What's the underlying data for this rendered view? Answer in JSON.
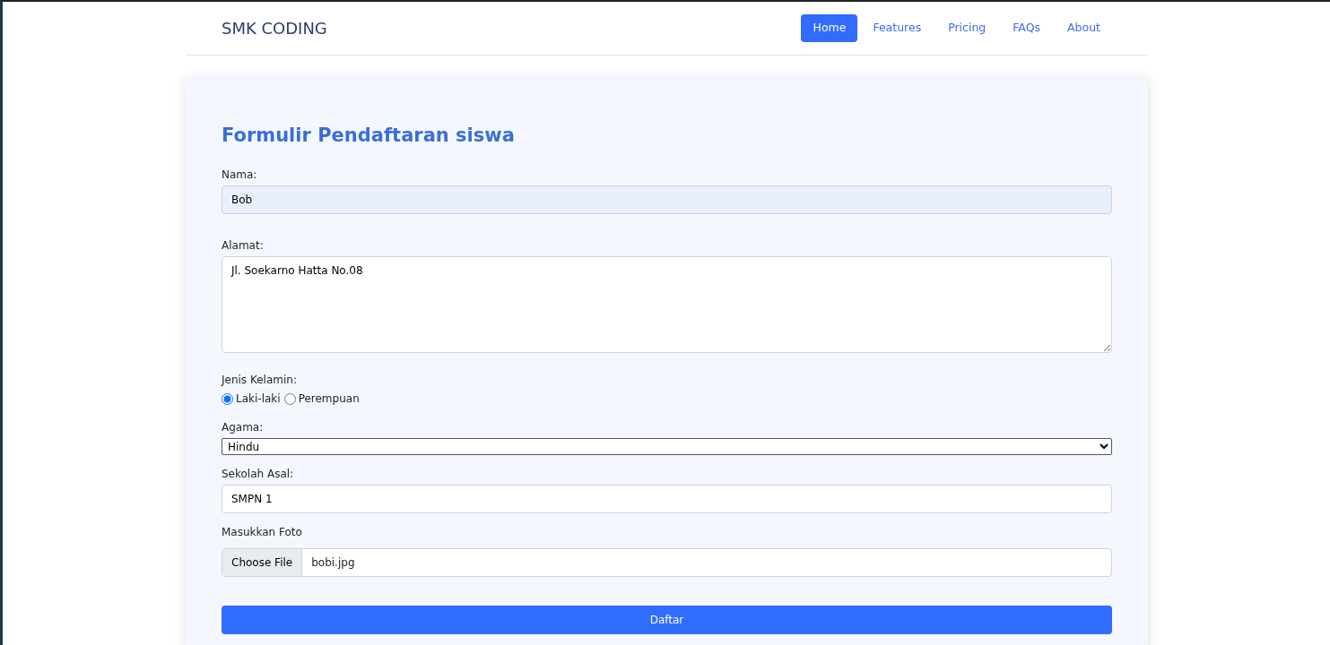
{
  "brand": "SMK CODING",
  "nav": [
    {
      "label": "Home",
      "selected": true
    },
    {
      "label": "Features",
      "selected": false
    },
    {
      "label": "Pricing",
      "selected": false
    },
    {
      "label": "FAQs",
      "selected": false
    },
    {
      "label": "About",
      "selected": false
    }
  ],
  "form": {
    "title": "Formulir Pendaftaran siswa",
    "nama": {
      "label": "Nama:",
      "value": "Bob"
    },
    "alamat": {
      "label": "Alamat:",
      "value": "Jl. Soekarno Hatta No.08"
    },
    "jenis_kelamin": {
      "label": "Jenis Kelamin:",
      "options": [
        {
          "label": "Laki-laki",
          "selected": true
        },
        {
          "label": "Perempuan",
          "selected": false
        }
      ]
    },
    "agama": {
      "label": "Agama:",
      "value": "Hindu"
    },
    "sekolah_asal": {
      "label": "Sekolah Asal:",
      "value": "SMPN 1"
    },
    "foto": {
      "label": "Masukkan Foto",
      "button": "Choose File",
      "value": "bobi.jpg"
    },
    "submit": "Daftar"
  }
}
